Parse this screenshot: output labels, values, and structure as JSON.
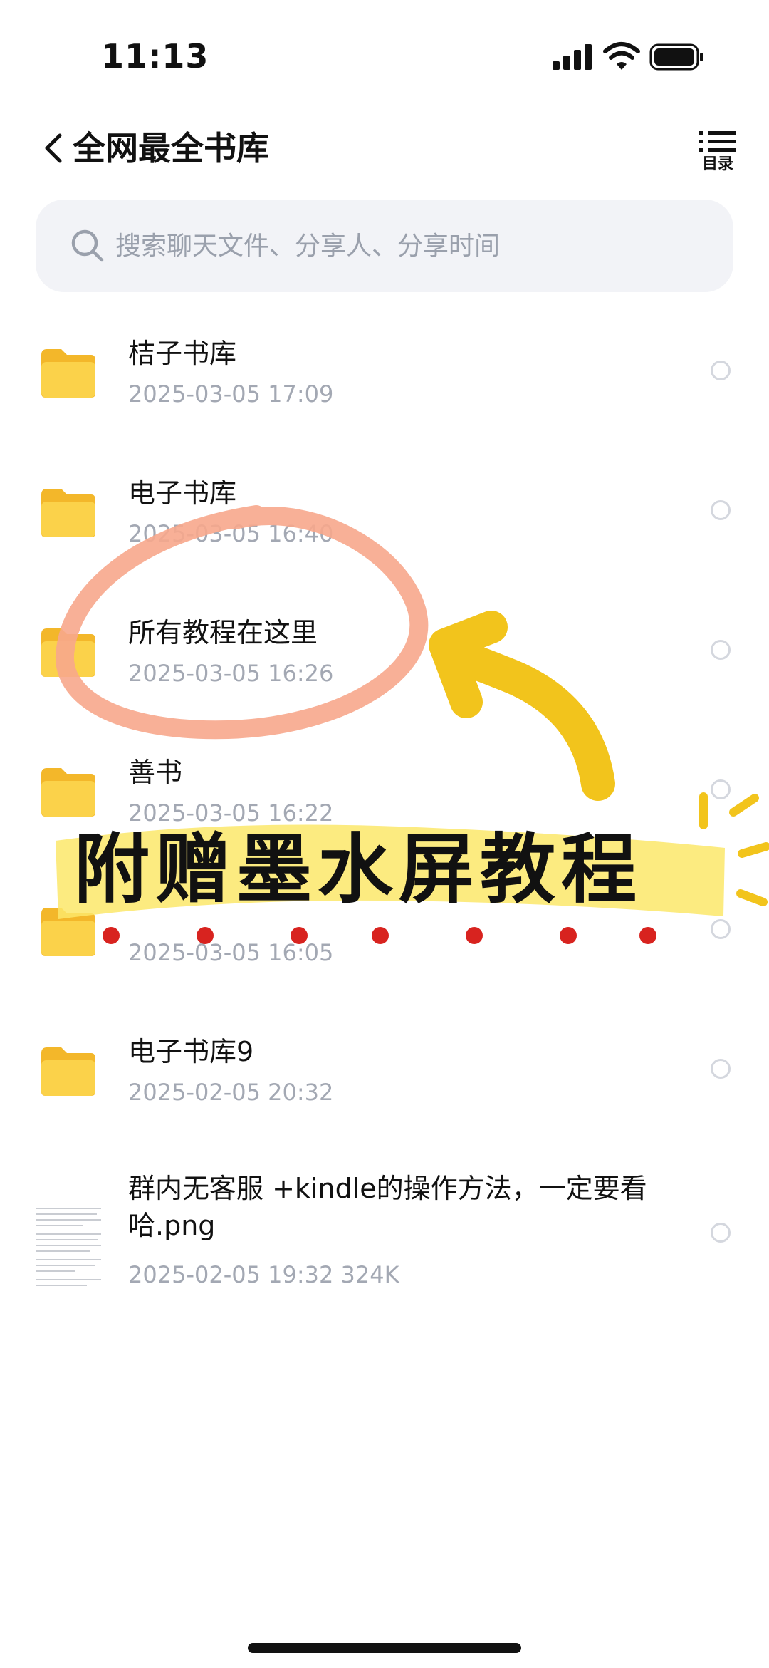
{
  "status_bar": {
    "time": "11:13"
  },
  "header": {
    "title": "全网最全书库",
    "toc_label": "目录"
  },
  "search": {
    "placeholder": "搜索聊天文件、分享人、分享时间"
  },
  "files": [
    {
      "name": "桔子书库",
      "meta": "2025-03-05 17:09",
      "type": "folder"
    },
    {
      "name": "电子书库",
      "meta": "2025-03-05 16:40",
      "type": "folder"
    },
    {
      "name": "所有教程在这里",
      "meta": "2025-03-05 16:26",
      "type": "folder"
    },
    {
      "name": "善书",
      "meta": "2025-03-05 16:22",
      "type": "folder"
    },
    {
      "name": "",
      "meta": "2025-03-05 16:05",
      "type": "folder"
    },
    {
      "name": "电子书库9",
      "meta": "2025-02-05 20:32",
      "type": "folder"
    },
    {
      "name": "群内无客服 +kindle的操作方法，一定要看哈.png",
      "meta": "2025-02-05 19:32   324K",
      "type": "image"
    }
  ],
  "overlay": {
    "banner_text": "附赠墨水屏教程"
  },
  "colors": {
    "folder": "#f9c93c",
    "circle_annotation": "#f7a78c",
    "arrow": "#f2c41c",
    "highlight": "#fbe86a",
    "dots": "#d8231f"
  },
  "icons": {
    "back": "chevron-left-icon",
    "toc": "list-icon",
    "search": "search-icon",
    "folder": "folder-icon"
  }
}
